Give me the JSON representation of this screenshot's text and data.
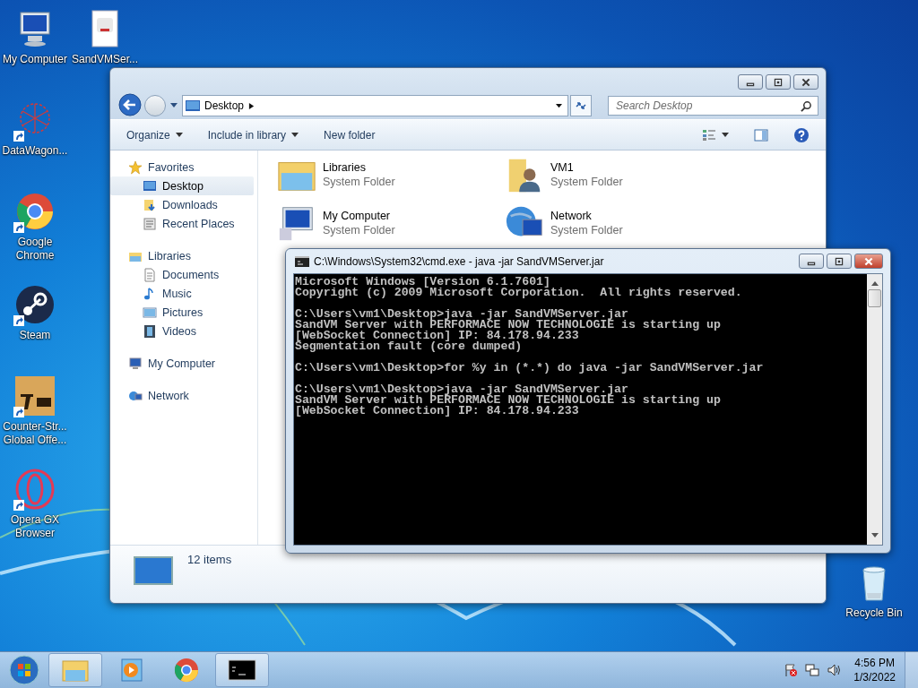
{
  "desktop_icons": [
    {
      "label": "My Computer",
      "kind": "computer",
      "shortcut": false
    },
    {
      "label": "SandVMSer...",
      "kind": "java",
      "shortcut": false
    },
    {
      "label": "DataWagon...",
      "kind": "datawagon",
      "shortcut": true
    },
    {
      "label": "Google Chrome",
      "kind": "chrome",
      "shortcut": true
    },
    {
      "label": "Steam",
      "kind": "steam",
      "shortcut": true
    },
    {
      "label": "Counter-Str... Global Offe...",
      "kind": "csgo",
      "shortcut": true
    },
    {
      "label": "Opera GX Browser",
      "kind": "opera",
      "shortcut": true
    },
    {
      "label": "Recycle Bin",
      "kind": "recycle",
      "shortcut": false
    }
  ],
  "explorer": {
    "address": "Desktop",
    "search": {
      "placeholder": "Search Desktop"
    },
    "toolbar": [
      {
        "label": "Organize",
        "dropdown": true
      },
      {
        "label": "Include in library",
        "dropdown": true
      },
      {
        "label": "New folder",
        "dropdown": false
      }
    ],
    "nav": [
      {
        "label": "Favorites",
        "kind": "star",
        "selected": false,
        "children": [
          {
            "label": "Desktop",
            "kind": "desktop",
            "selected": true
          },
          {
            "label": "Downloads",
            "kind": "downloads",
            "selected": false
          },
          {
            "label": "Recent Places",
            "kind": "recent",
            "selected": false
          }
        ]
      },
      {
        "label": "Libraries",
        "kind": "library",
        "selected": false,
        "children": [
          {
            "label": "Documents",
            "kind": "document",
            "selected": false
          },
          {
            "label": "Music",
            "kind": "music",
            "selected": false
          },
          {
            "label": "Pictures",
            "kind": "pictures",
            "selected": false
          },
          {
            "label": "Videos",
            "kind": "videos",
            "selected": false
          }
        ]
      },
      {
        "label": "My Computer",
        "kind": "computer",
        "selected": false
      },
      {
        "label": "Network",
        "kind": "network",
        "selected": false
      }
    ],
    "items": [
      {
        "name": "Libraries",
        "type": "System Folder",
        "kind": "library"
      },
      {
        "name": "VM1",
        "type": "System Folder",
        "kind": "user"
      },
      {
        "name": "My Computer",
        "type": "System Folder",
        "kind": "computer"
      },
      {
        "name": "Network",
        "type": "System Folder",
        "kind": "network"
      }
    ],
    "status": "12 items"
  },
  "cmd": {
    "title": "C:\\Windows\\System32\\cmd.exe - java  -jar SandVMServer.jar",
    "blocks": [
      [
        "Microsoft Windows [Version 6.1.7601]",
        "Copyright (c) 2009 Microsoft Corporation.  All rights reserved."
      ],
      [
        "C:\\Users\\vm1\\Desktop>java -jar SandVMServer.jar",
        "SandVM Server with PERFORMACE NOW TECHNOLOGIE is starting up",
        "[WebSocket Connection] IP: 84.178.94.233",
        "Segmentation fault (core dumped)"
      ],
      [
        "C:\\Users\\vm1\\Desktop>for %y in (*.*) do java -jar SandVMServer.jar"
      ],
      [
        "C:\\Users\\vm1\\Desktop>java -jar SandVMServer.jar",
        "SandVM Server with PERFORMACE NOW TECHNOLOGIE is starting up",
        "[WebSocket Connection] IP: 84.178.94.233"
      ]
    ]
  },
  "taskbar": {
    "apps": [
      {
        "kind": "explorer",
        "active": true
      },
      {
        "kind": "media",
        "active": false
      },
      {
        "kind": "chrome",
        "active": false
      },
      {
        "kind": "cmd",
        "active": true
      }
    ],
    "time": "4:56 PM",
    "date": "1/3/2022"
  }
}
